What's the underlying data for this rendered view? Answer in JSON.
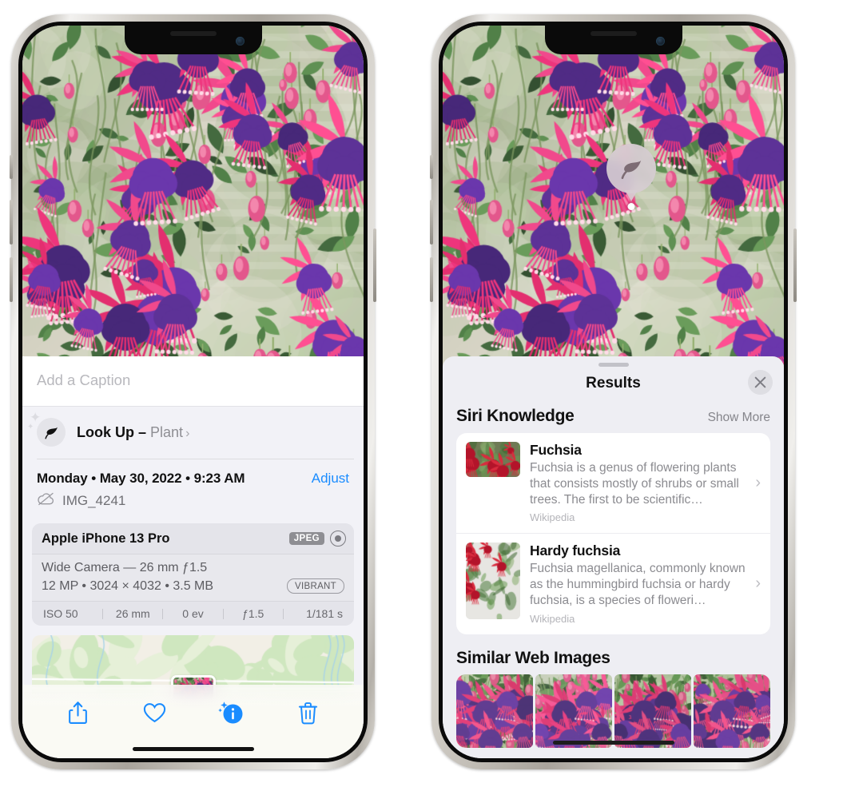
{
  "left_phone": {
    "photo_alt": "fuchsia-flowers-photo",
    "caption_placeholder": "Add a Caption",
    "lookup": {
      "icon": "leaf-icon",
      "label": "Look Up – ",
      "bold_label": "Look Up –",
      "subject": "Plant",
      "chevron": "›"
    },
    "metadata": {
      "date": "Monday • May 30, 2022 • 9:23 AM",
      "adjust_label": "Adjust",
      "cloud_icon": "cloud-slash-icon",
      "filename": "IMG_4241"
    },
    "exif": {
      "device": "Apple iPhone 13 Pro",
      "format_chip": "JPEG",
      "raw_icon": "raw-target-icon",
      "lens_line": "Wide Camera — 26 mm ƒ1.5",
      "size_line": "12 MP • 3024 × 4032 • 3.5 MB",
      "style_chip": "VIBRANT",
      "stats": [
        "ISO 50",
        "26 mm",
        "0 ev",
        "ƒ1.5",
        "1/181 s"
      ]
    },
    "map": {
      "name": "location-map",
      "pin": "photo-pin-thumbnail"
    },
    "toolbar": [
      {
        "name": "share-button",
        "icon": "share-icon"
      },
      {
        "name": "favorite-button",
        "icon": "heart-icon"
      },
      {
        "name": "info-button",
        "icon": "info-sparkle-icon"
      },
      {
        "name": "delete-button",
        "icon": "trash-icon"
      }
    ],
    "accent_color": "#1a8cff"
  },
  "right_phone": {
    "photo_alt": "fuchsia-flowers-photo",
    "visual_lookup_badge": {
      "icon": "leaf-icon",
      "name": "visual-lookup-badge"
    },
    "sheet": {
      "grabber": "sheet-grabber",
      "title": "Results",
      "close_icon": "close-icon"
    },
    "siri_knowledge": {
      "title": "Siri Knowledge",
      "show_more": "Show More",
      "items": [
        {
          "title": "Fuchsia",
          "description": "Fuchsia is a genus of flowering plants that consists mostly of shrubs or small trees. The first to be scientific…",
          "source": "Wikipedia",
          "thumb": "fuchsia-red-flowers-thumb"
        },
        {
          "title": "Hardy fuchsia",
          "description": "Fuchsia magellanica, commonly known as the hummingbird fuchsia or hardy fuchsia, is a species of floweri…",
          "source": "Wikipedia",
          "thumb": "hardy-fuchsia-branch-thumb"
        }
      ]
    },
    "similar_web_images": {
      "title": "Similar Web Images",
      "tiles": [
        "fuchsia-pink-white-bloom",
        "fuchsia-red-closeup",
        "fuchsia-bush-buds",
        "fuchsia-purple-pink-double"
      ]
    }
  }
}
